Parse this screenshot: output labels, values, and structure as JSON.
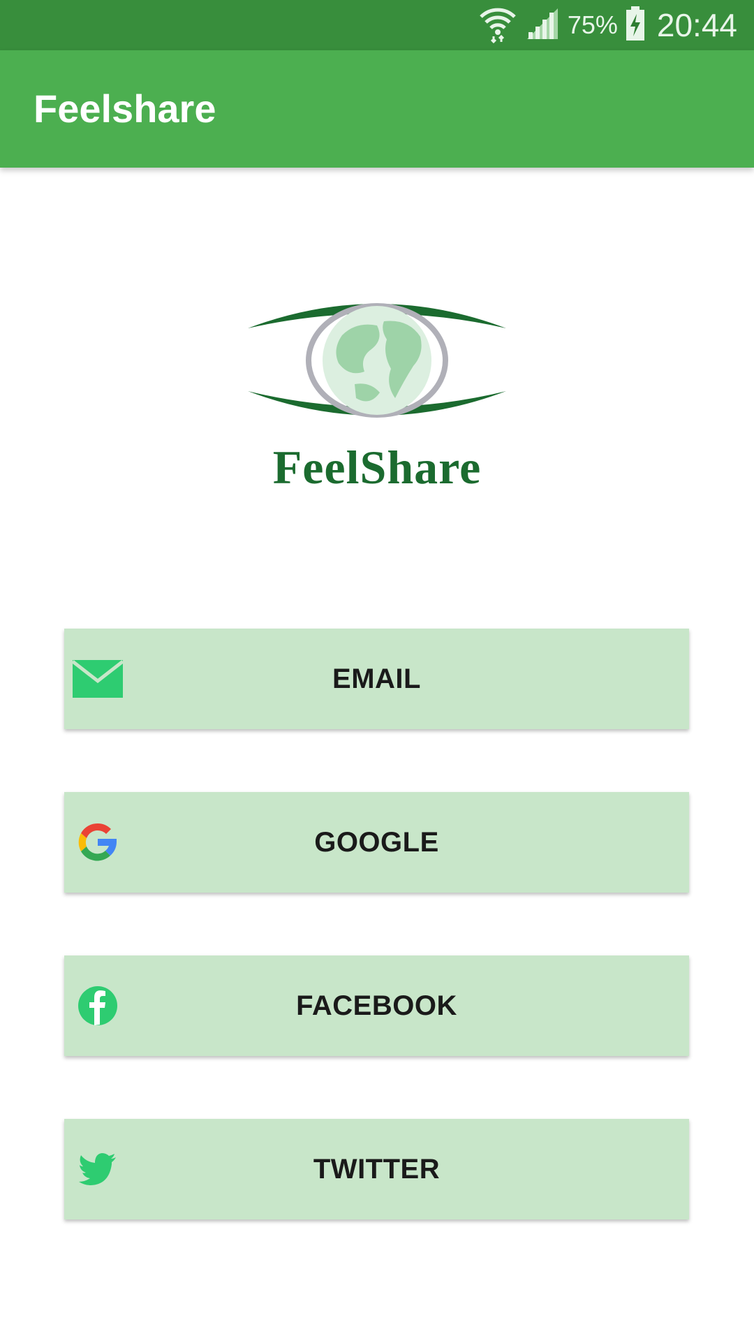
{
  "status_bar": {
    "battery_text": "75%",
    "time": "20:44",
    "icons": [
      "wifi-icon",
      "signal-icon",
      "battery-charging-icon"
    ]
  },
  "app_bar": {
    "title": "Feelshare"
  },
  "logo": {
    "text": "FeelShare"
  },
  "buttons": [
    {
      "label": "EMAIL",
      "icon": "email-icon"
    },
    {
      "label": "GOOGLE",
      "icon": "google-icon"
    },
    {
      "label": "FACEBOOK",
      "icon": "facebook-icon"
    },
    {
      "label": "TWITTER",
      "icon": "twitter-icon"
    }
  ],
  "colors": {
    "status_bar": "#388E3C",
    "app_bar": "#4CAF50",
    "button_bg": "#C8E6C9",
    "icon_green": "#2ECC71",
    "logo_green": "#1B6B2F"
  }
}
